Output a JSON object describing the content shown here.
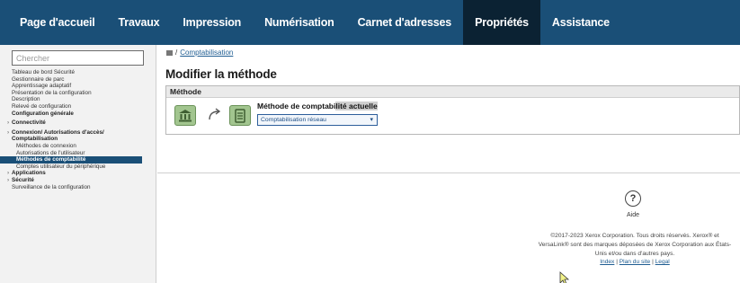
{
  "nav": {
    "tabs": [
      {
        "label": "Page d'accueil"
      },
      {
        "label": "Travaux"
      },
      {
        "label": "Impression"
      },
      {
        "label": "Numérisation"
      },
      {
        "label": "Carnet d'adresses"
      },
      {
        "label": "Propriétés"
      },
      {
        "label": "Assistance"
      }
    ],
    "active": "Propriétés"
  },
  "sidebar": {
    "search_placeholder": "Chercher",
    "items": [
      "Tableau de bord Sécurité",
      "Gestionnaire de parc",
      "Apprentissage adaptatif",
      "Présentation de la configuration",
      "Description",
      "Relevé de configuration",
      "Configuration générale",
      "Connectivité",
      "Connexion/ Autorisations d'accès/",
      "Comptabilisation",
      "Méthodes de connexion",
      "Autorisations de l'utilisateur",
      "Méthodes de comptabilité",
      "Comptes utilisateur du périphérique",
      "Applications",
      "Sécurité",
      "Surveillance de la configuration"
    ]
  },
  "main": {
    "breadcrumb_sep": "/",
    "breadcrumb_link": "Comptabilisation",
    "title": "Modifier la méthode",
    "panel_header": "Méthode",
    "method_label_a": "Méthode de comptabi",
    "method_label_b": "lité actuelle",
    "select_value": "Comptabilisation réseau",
    "help_label": "Aide",
    "footer_text": "©2017-2023 Xerox Corporation. Tous droits réservés. Xerox® et VersaLink® sont des marques déposées de Xerox Corporation aux États-Unis et/ou dans d'autres pays.",
    "footer_links": [
      "Index",
      "Plan du site",
      "Legal"
    ],
    "footer_link_sep": "|"
  },
  "colors": {
    "nav_bg": "#1a4f77",
    "nav_active": "#0b2233",
    "icon_green": "#a2c58f",
    "selected_item": "#1a4f77"
  },
  "icons": [
    "bank-icon",
    "swap-arrow-icon",
    "device-icon",
    "help-icon",
    "chevron-down-icon",
    "home-icon"
  ]
}
